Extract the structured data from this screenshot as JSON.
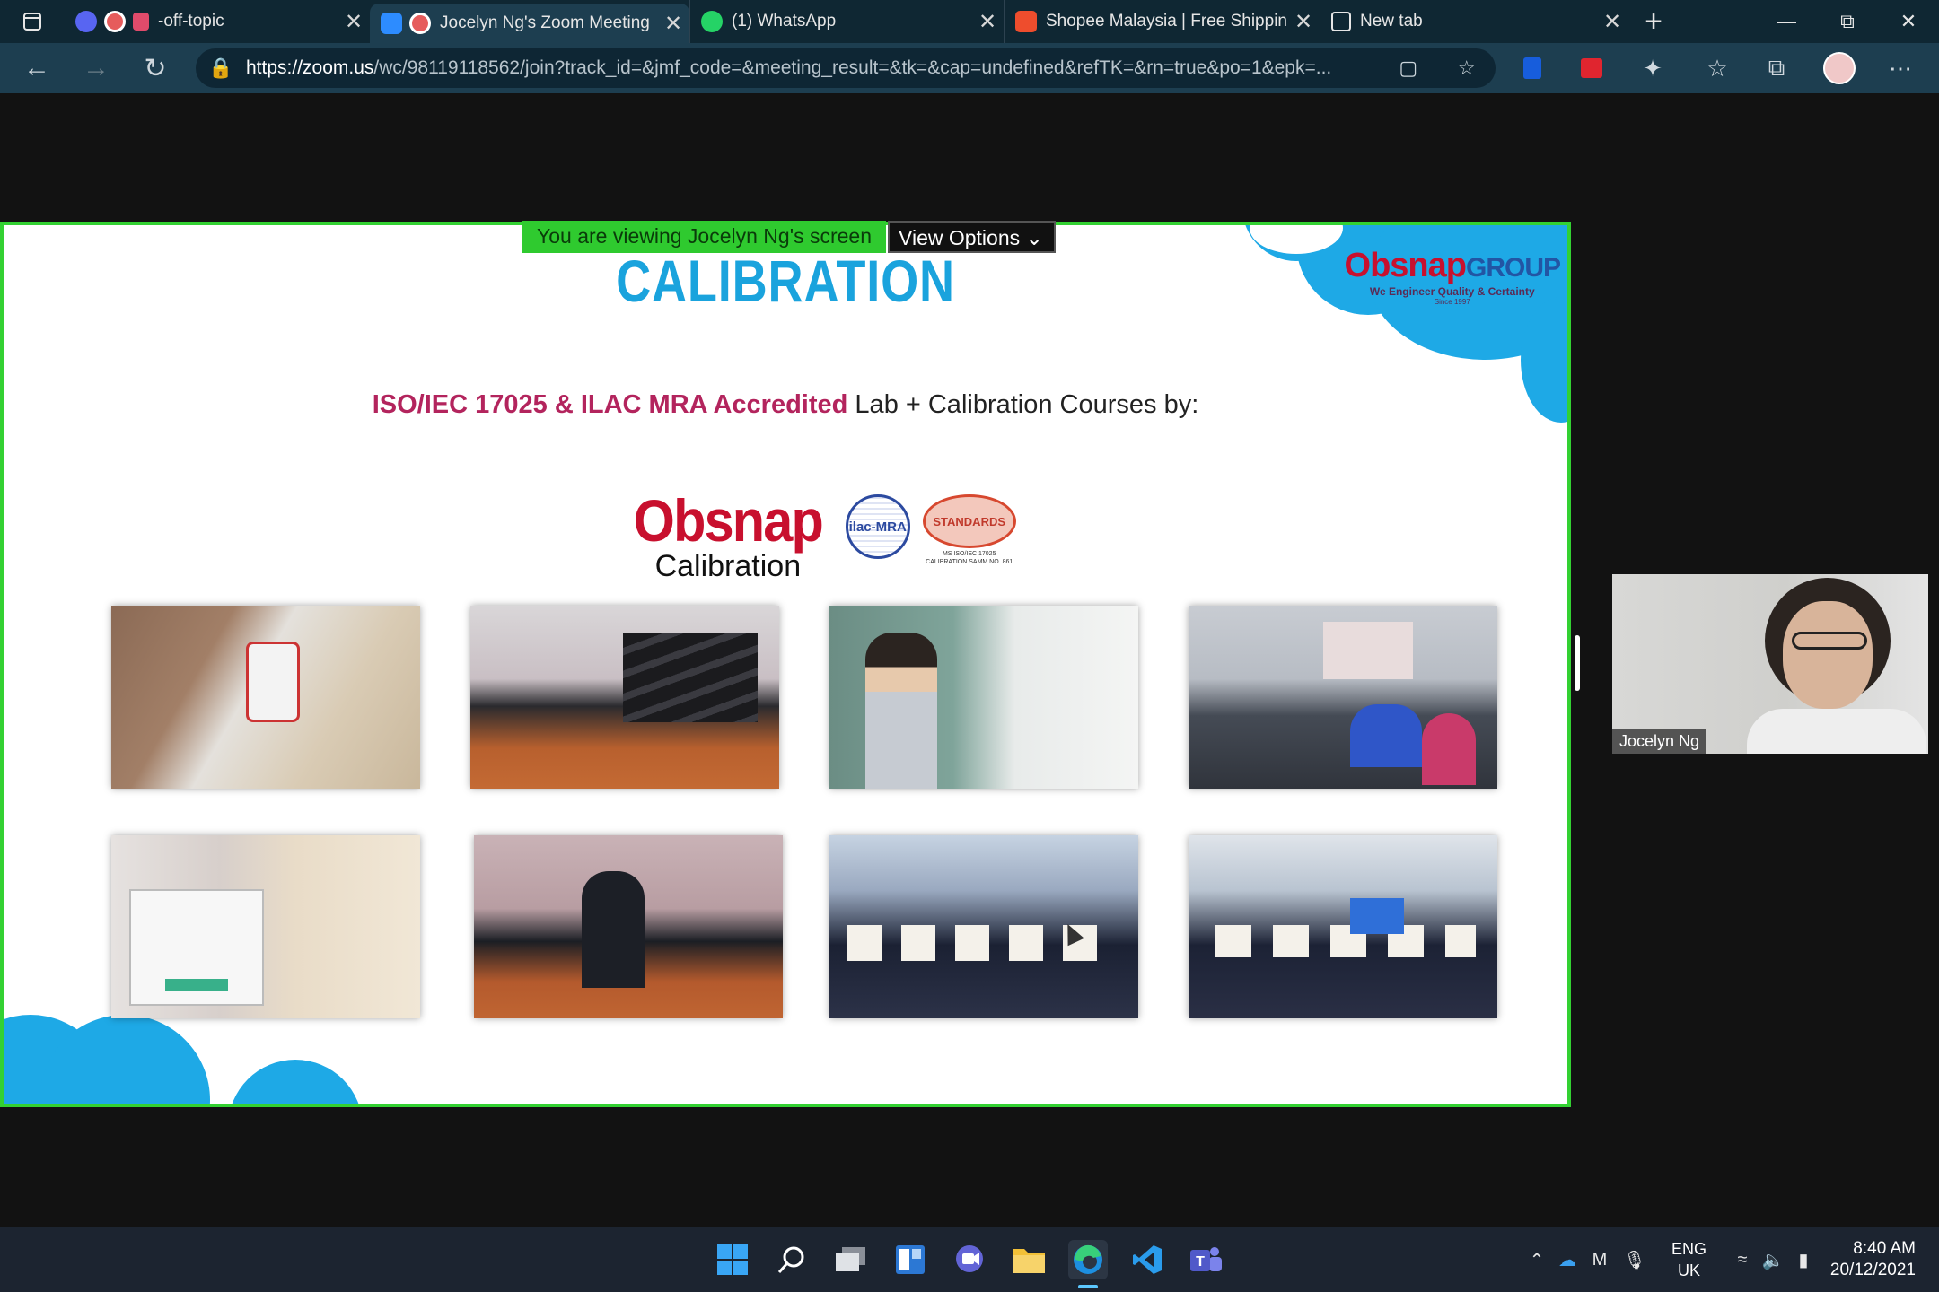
{
  "browser": {
    "tabs": [
      {
        "title": "-off-topic",
        "close": "✕"
      },
      {
        "title": "Jocelyn Ng's Zoom Meeting",
        "close": "✕"
      },
      {
        "title": "(1) WhatsApp",
        "close": "✕"
      },
      {
        "title": "Shopee Malaysia | Free Shipping",
        "close": "✕"
      },
      {
        "title": "New tab",
        "close": "✕"
      }
    ],
    "new_tab": "+",
    "url_host": "https://zoom.us",
    "url_path": "/wc/98119118562/join?track_id=&jmf_code=&meeting_result=&tk=&cap=undefined&refTK=&rn=true&po=1&epk=..."
  },
  "meeting": {
    "viewing_banner": "You are viewing Jocelyn Ng's screen",
    "view_options": "View Options",
    "view_options_chevron": "⌄",
    "participant_name": "Jocelyn Ng"
  },
  "slide": {
    "title": "CALIBRATION",
    "brand_main": "Obsnap",
    "brand_group": "GROUP",
    "brand_tagline": "We Engineer Quality & Certainty",
    "brand_since": "Since 1997",
    "subtitle_accent": "ISO/IEC 17025 & ILAC MRA Accredited",
    "subtitle_rest": " Lab + Calibration Courses by:",
    "logo_obsnap": "Obsnap",
    "logo_calibration": "Calibration",
    "logo_ilac": "ilac-MRA",
    "logo_standards": "STANDARDS",
    "logo_standards_sub": "MS ISO/IEC 17025 CALIBRATION SAMM NO. 861"
  },
  "taskbar": {
    "lang_top": "ENG",
    "lang_bottom": "UK",
    "time": "8:40 AM",
    "date": "20/12/2021"
  }
}
